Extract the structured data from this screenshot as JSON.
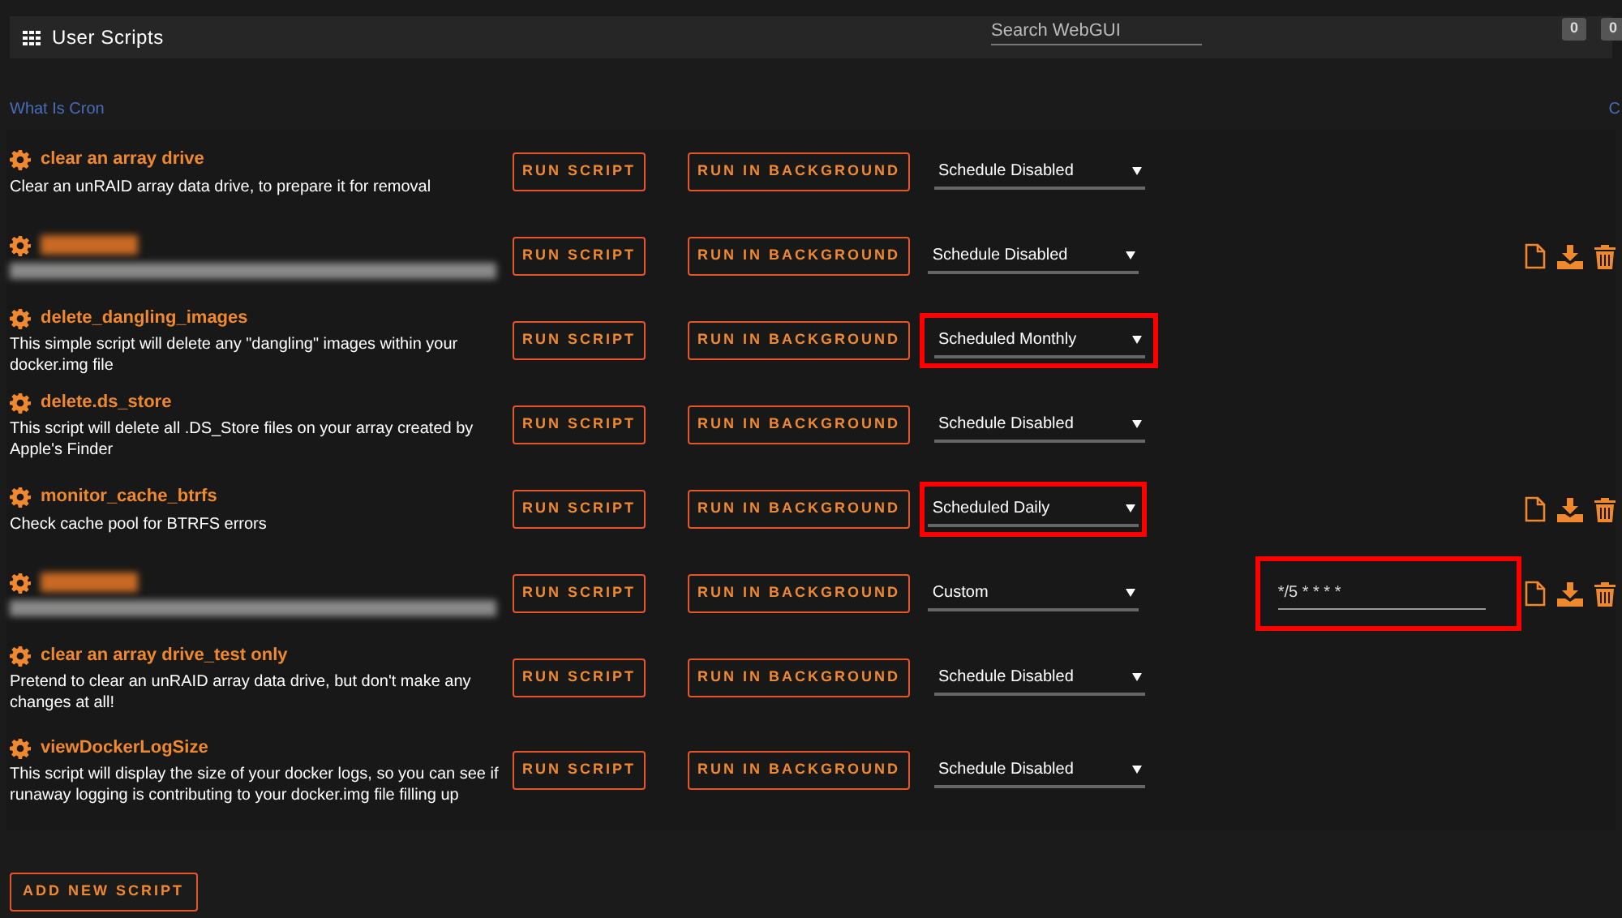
{
  "header": {
    "title": "User Scripts",
    "search": {
      "placeholder": "Search WebGUI"
    },
    "badges": [
      "0",
      "0"
    ]
  },
  "links": {
    "left": "What Is Cron",
    "right": "C"
  },
  "scripts": [
    {
      "name": "clear an array drive",
      "description": "Clear an unRAID array data drive, to prepare it for removal",
      "redacted": false,
      "run_label": "RUN SCRIPT",
      "background_label": "RUN IN BACKGROUND",
      "schedule": "Schedule Disabled",
      "highlighted": false,
      "actions": false
    },
    {
      "redacted": true,
      "run_label": "RUN SCRIPT",
      "background_label": "RUN IN BACKGROUND",
      "schedule": "Schedule Disabled",
      "highlighted": false,
      "actions": true
    },
    {
      "name": "delete_dangling_images",
      "description": "This simple script will delete any \"dangling\" images within your docker.img file",
      "redacted": false,
      "run_label": "RUN SCRIPT",
      "background_label": "RUN IN BACKGROUND",
      "schedule": "Scheduled Monthly",
      "highlighted": true,
      "actions": false
    },
    {
      "name": "delete.ds_store",
      "description": "This script will delete all .DS_Store files on your array created by Apple's Finder",
      "redacted": false,
      "run_label": "RUN SCRIPT",
      "background_label": "RUN IN BACKGROUND",
      "schedule": "Schedule Disabled",
      "highlighted": false,
      "actions": false
    },
    {
      "name": "monitor_cache_btrfs",
      "description": "Check cache pool for BTRFS errors",
      "redacted": false,
      "run_label": "RUN SCRIPT",
      "background_label": "RUN IN BACKGROUND",
      "schedule": "Scheduled Daily",
      "highlighted": true,
      "actions": true
    },
    {
      "redacted": true,
      "run_label": "RUN SCRIPT",
      "background_label": "RUN IN BACKGROUND",
      "schedule": "Custom",
      "highlighted": false,
      "cron": "*/5 * * * *",
      "cron_highlighted": true,
      "actions": true
    },
    {
      "name": "clear an array drive_test only",
      "description": "Pretend to clear an unRAID array data drive, but don't make any changes at all!",
      "redacted": false,
      "run_label": "RUN SCRIPT",
      "background_label": "RUN IN BACKGROUND",
      "schedule": "Schedule Disabled",
      "highlighted": false,
      "actions": false
    },
    {
      "name": "viewDockerLogSize",
      "description": "This script will display the size of your docker logs, so you can see if runaway logging is contributing to your docker.img file filling up",
      "redacted": false,
      "run_label": "RUN SCRIPT",
      "background_label": "RUN IN BACKGROUND",
      "schedule": "Schedule Disabled",
      "highlighted": false,
      "actions": false
    }
  ],
  "add_button": "ADD NEW SCRIPT"
}
